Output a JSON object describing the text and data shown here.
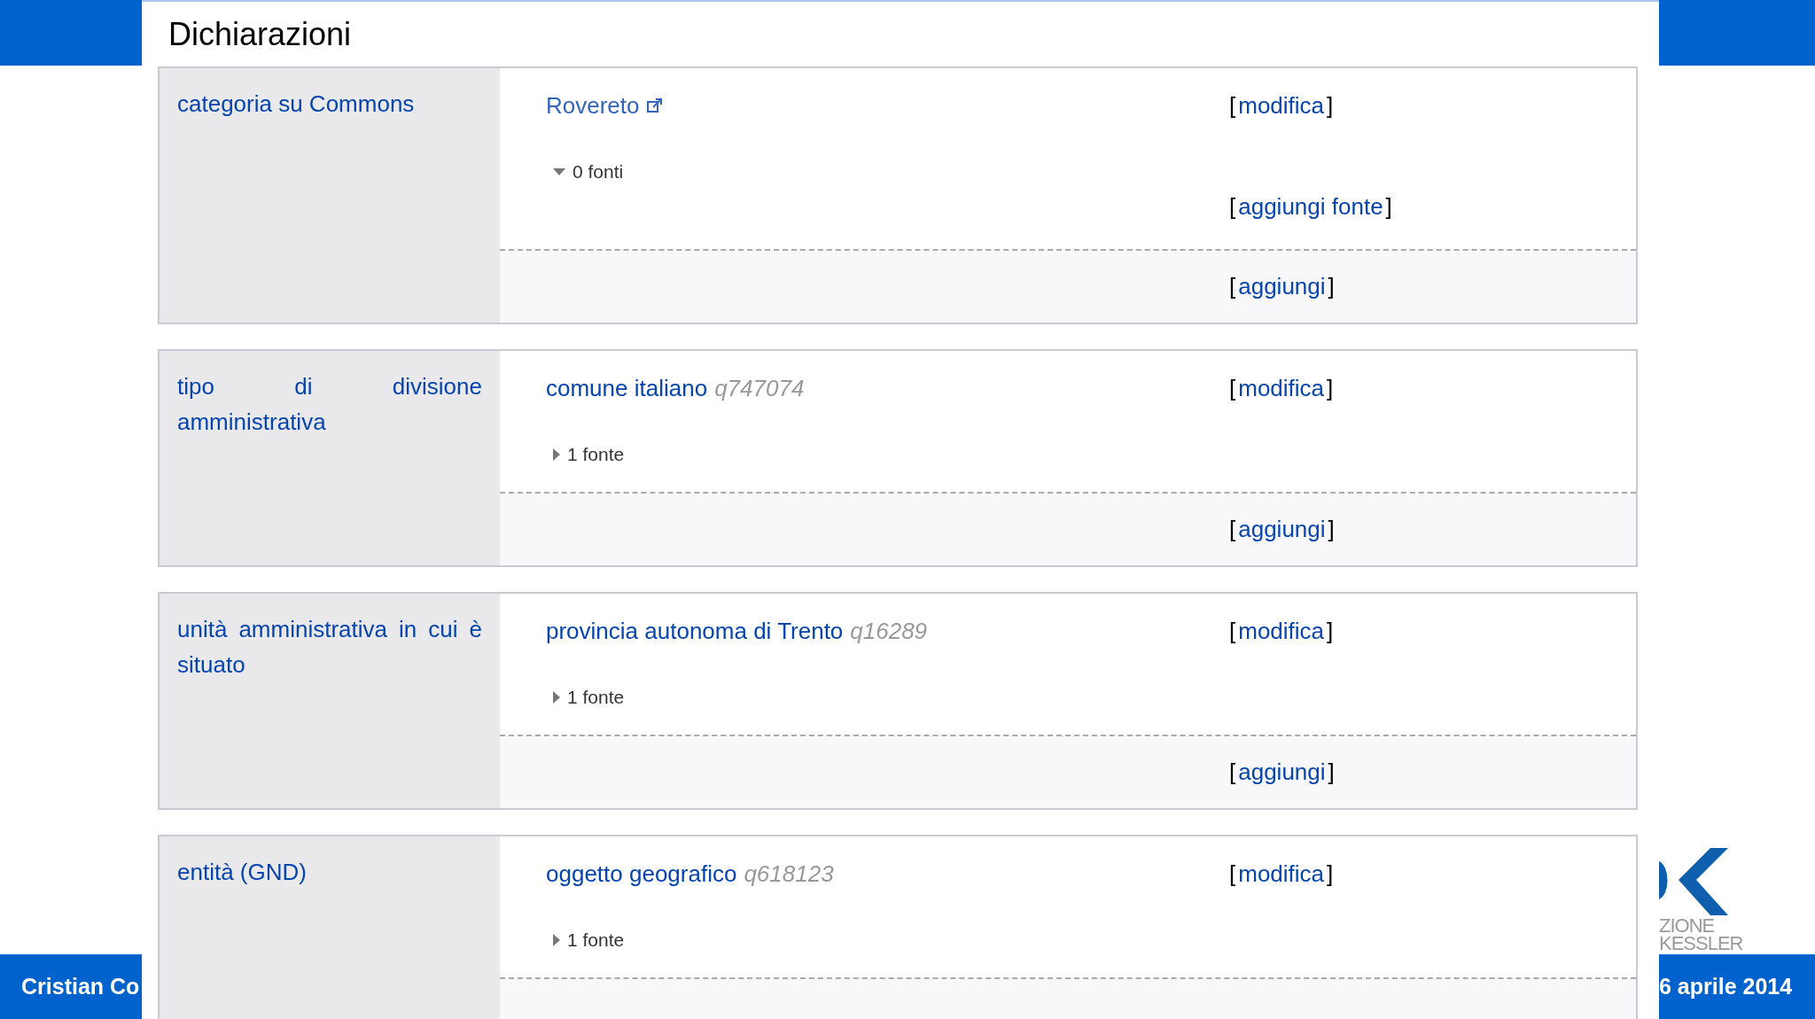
{
  "section_title": "Dichiarazioni",
  "statements": [
    {
      "property": "categoria su Commons",
      "value": "Rovereto",
      "kind": "external",
      "references": {
        "label": "0 fonti",
        "expanded": true
      },
      "edit": {
        "open": "[",
        "label": "modifica",
        "close": "]"
      },
      "add_reference": {
        "open": "[",
        "label": "aggiungi fonte",
        "close": "]"
      },
      "add": {
        "open": "[",
        "label": "aggiungi",
        "close": "]"
      }
    },
    {
      "property": "tipo di divisione amministrativa",
      "value": "comune italiano",
      "qid": "q747074",
      "kind": "item",
      "references": {
        "label": "1 fonte",
        "expanded": false
      },
      "edit": {
        "open": "[",
        "label": "modifica",
        "close": "]"
      },
      "add": {
        "open": "[",
        "label": "aggiungi",
        "close": "]"
      }
    },
    {
      "property": "unità amministrativa in cui è situato",
      "value": "provincia autonoma di Trento",
      "qid": "q16289",
      "kind": "item",
      "references": {
        "label": "1 fonte",
        "expanded": false
      },
      "edit": {
        "open": "[",
        "label": "modifica",
        "close": "]"
      },
      "add": {
        "open": "[",
        "label": "aggiungi",
        "close": "]"
      }
    },
    {
      "property": "entità (GND)",
      "value": "oggetto geografico",
      "qid": "q618123",
      "kind": "item",
      "references": {
        "label": "1 fonte",
        "expanded": false
      },
      "edit": {
        "open": "[",
        "label": "modifica",
        "close": "]"
      }
    }
  ],
  "slide": {
    "author": "Cristian Co",
    "date": "6 aprile 2014",
    "logo_lines": [
      "ZIONE",
      "KESSLER"
    ]
  }
}
